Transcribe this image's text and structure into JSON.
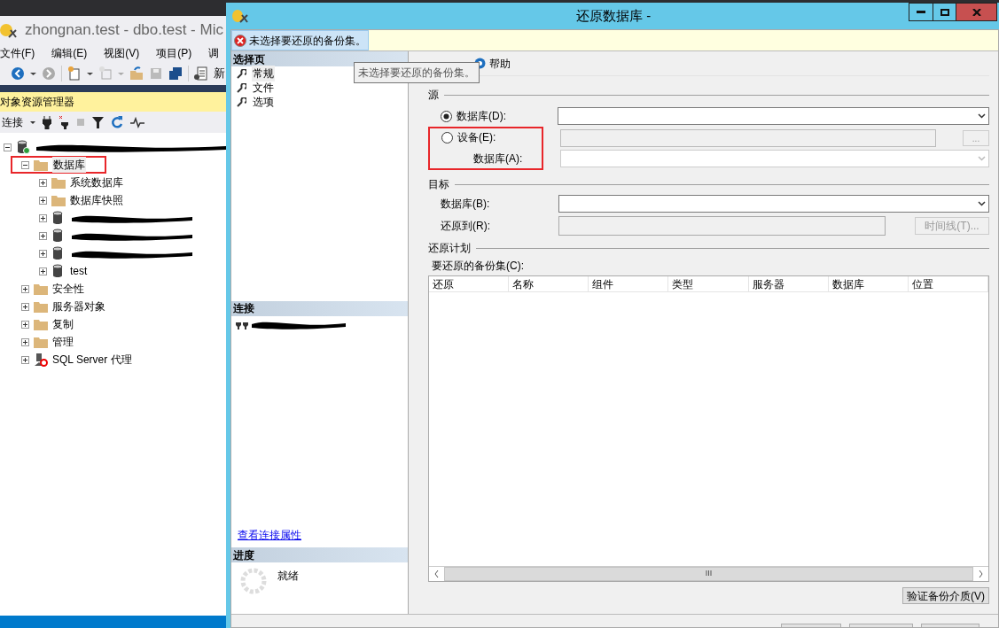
{
  "left_window": {
    "title": "zhongnan.test - dbo.test - Mic",
    "menu": [
      "文件(F)",
      "编辑(E)",
      "视图(V)",
      "项目(P)",
      "调"
    ],
    "toolbar_label": "新",
    "explorer": {
      "title": "对象资源管理器",
      "connect": "连接"
    },
    "tree": [
      {
        "kind": "server",
        "expanded": true,
        "highlighted": false,
        "children": [
          {
            "kind": "folder",
            "label": "数据库",
            "expanded": true,
            "highlighted": true,
            "children": [
              {
                "kind": "folder",
                "label": "系统数据库",
                "expanded": false,
                "highlighted": false
              },
              {
                "kind": "folder",
                "label": "数据库快照",
                "expanded": false,
                "highlighted": false
              },
              {
                "kind": "redacted",
                "expanded": false,
                "highlighted": false
              },
              {
                "kind": "redacted",
                "expanded": false,
                "highlighted": false
              },
              {
                "kind": "redacted",
                "expanded": false,
                "highlighted": false
              },
              {
                "kind": "database",
                "label": "test",
                "expanded": false,
                "highlighted": false
              }
            ]
          },
          {
            "kind": "folder",
            "label": "安全性",
            "expanded": false,
            "highlighted": false
          },
          {
            "kind": "folder",
            "label": "服务器对象",
            "expanded": false,
            "highlighted": false
          },
          {
            "kind": "folder",
            "label": "复制",
            "expanded": false,
            "highlighted": false
          },
          {
            "kind": "folder",
            "label": "管理",
            "expanded": false,
            "highlighted": false
          },
          {
            "kind": "agent",
            "label": "SQL Server 代理",
            "expanded": false,
            "highlighted": false
          }
        ]
      }
    ]
  },
  "dialog": {
    "title": "还原数据库 -",
    "message": "未选择要还原的备份集。",
    "tooltip": "未选择要还原的备份集。",
    "pages_header": "选择页",
    "pages": [
      {
        "label": "常规",
        "selected": true
      },
      {
        "label": "文件",
        "selected": false
      },
      {
        "label": "选项",
        "selected": false
      }
    ],
    "connection_header": "连接",
    "connection_link": "查看连接属性",
    "progress_header": "进度",
    "progress_status": "就绪",
    "help": "帮助",
    "source": {
      "title": "源",
      "highlighted": true,
      "options": [
        {
          "label": "数据库(D):",
          "selected": true
        },
        {
          "label": "设备(E):",
          "selected": false
        }
      ],
      "device_database_label": "数据库(A):",
      "browse": "..."
    },
    "destination": {
      "title": "目标",
      "database_label": "数据库(B):",
      "restore_to_label": "还原到(R):",
      "timeline": "时间线(T)..."
    },
    "plan": {
      "title": "还原计划",
      "table_label": "要还原的备份集(C):",
      "columns": [
        "还原",
        "名称",
        "组件",
        "类型",
        "服务器",
        "数据库",
        "位置"
      ],
      "scroll_thumb": "III"
    },
    "verify_button": "验证备份介质(V)"
  }
}
